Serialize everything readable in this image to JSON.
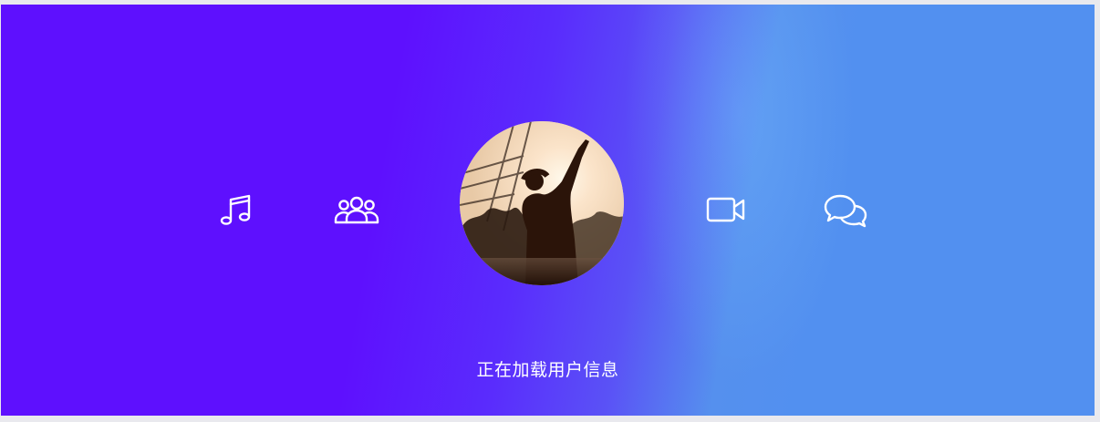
{
  "status": {
    "text": "正在加载用户信息"
  },
  "nav": {
    "left_icons": [
      {
        "name": "music-note-icon"
      },
      {
        "name": "users-group-icon"
      }
    ],
    "right_icons": [
      {
        "name": "video-camera-icon"
      },
      {
        "name": "chat-bubbles-icon"
      }
    ]
  },
  "avatar": {
    "description_icon": "user-avatar"
  },
  "colors": {
    "gradient_left": "#5e10fe",
    "gradient_right": "#5290f0",
    "icon_color": "#ffffff",
    "text_color": "#ffffff"
  }
}
